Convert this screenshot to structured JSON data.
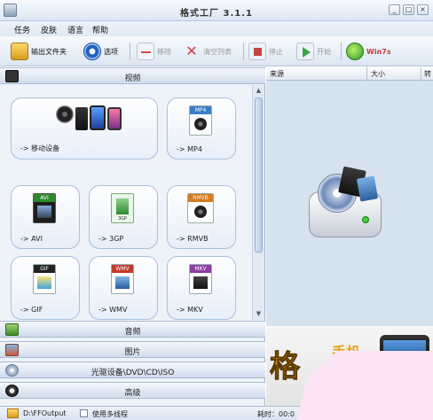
{
  "window": {
    "title": "格式工厂 3.1.1",
    "minimize": "_",
    "maximize": "□",
    "close": "×"
  },
  "menu": [
    "任务",
    "皮肤",
    "语言",
    "帮助"
  ],
  "toolbar": {
    "output_folder": "输出文件夹",
    "options": "选项",
    "remove": "移除",
    "clear_list": "清空列表",
    "stop": "停止",
    "start": "开始",
    "win7": "Win7s"
  },
  "categories": {
    "video": "视频",
    "audio": "音频",
    "picture": "图片",
    "rom": "光驱设备\\DVD\\CD\\ISO",
    "advanced": "高级"
  },
  "tiles": [
    {
      "label": "-> 移动设备",
      "badge": ""
    },
    {
      "label": "-> MP4",
      "badge": "MP4"
    },
    {
      "label": "-> AVI",
      "badge": "AVI"
    },
    {
      "label": "-> 3GP",
      "badge": "3GP"
    },
    {
      "label": "-> RMVB",
      "badge": "RMVB"
    },
    {
      "label": "-> GIF",
      "badge": "GIF"
    },
    {
      "label": "-> WMV",
      "badge": "WMV"
    },
    {
      "label": "-> MKV",
      "badge": "MKV"
    }
  ],
  "list_columns": {
    "source": "来源",
    "size": "大小",
    "convert": "转"
  },
  "banner": {
    "big": "格",
    "small": "手机"
  },
  "status": {
    "output_path": "D:\\FFOutput",
    "multithread": "使用多线程",
    "elapsed": "耗时：00:0"
  },
  "colors": {
    "accent": "#3c78c8",
    "pink": "#fde4f4"
  }
}
